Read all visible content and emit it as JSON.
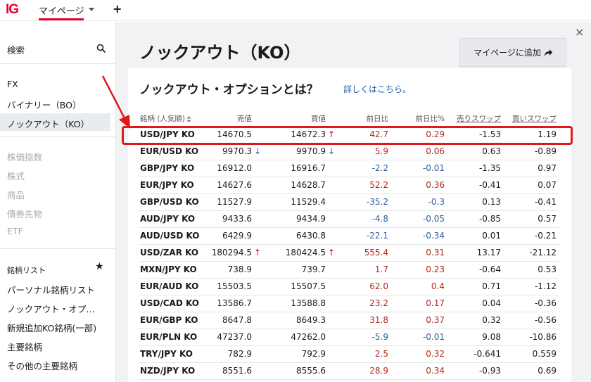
{
  "topbar": {
    "logo": "IG",
    "mypage_tab": "マイページ",
    "plus": "+"
  },
  "sidebar": {
    "search_label": "検索",
    "items": [
      {
        "label": "FX",
        "enabled": true
      },
      {
        "label": "バイナリー（BO）",
        "enabled": true
      },
      {
        "label": "ノックアウト（KO）",
        "enabled": true,
        "active": true
      },
      {
        "label": "株価指数",
        "enabled": false
      },
      {
        "label": "株式",
        "enabled": false
      },
      {
        "label": "商品",
        "enabled": false
      },
      {
        "label": "債券先物",
        "enabled": false
      },
      {
        "label": "ETF",
        "enabled": false
      }
    ],
    "watchlist_title": "銘柄リスト",
    "watchlists": [
      {
        "label": "パーソナル銘柄リスト"
      },
      {
        "label": "ノックアウト・オプ…"
      },
      {
        "label": "新規追加KO銘柄(一部)"
      },
      {
        "label": "主要銘柄"
      },
      {
        "label": "その他の主要銘柄"
      }
    ]
  },
  "main": {
    "page_title": "ノックアウト（KO）",
    "add_button": "マイページに追加",
    "close": "×",
    "card_title": "ノックアウト・オプションとは？",
    "card_link": "詳しくはこちら。"
  },
  "table": {
    "headers": {
      "name": "銘柄 (人気順)",
      "sell": "売値",
      "buy": "買値",
      "change": "前日比",
      "change_pct": "前日比%",
      "sell_swap": "売りスワップ",
      "buy_swap": "買いスワップ"
    },
    "rows": [
      {
        "name": "USD/JPY KO",
        "sell": "14670.5",
        "sell_arrow": "",
        "buy": "14672.3",
        "buy_arrow": "↑",
        "change": "42.7",
        "change_pct": "0.29",
        "sell_swap": "-1.53",
        "buy_swap": "1.19"
      },
      {
        "name": "EUR/USD KO",
        "sell": "9970.3",
        "sell_arrow": "↓",
        "buy": "9970.9",
        "buy_arrow": "↓",
        "change": "5.9",
        "change_pct": "0.06",
        "sell_swap": "0.63",
        "buy_swap": "-0.89"
      },
      {
        "name": "GBP/JPY KO",
        "sell": "16912.0",
        "sell_arrow": "",
        "buy": "16916.7",
        "buy_arrow": "",
        "change": "-2.2",
        "change_pct": "-0.01",
        "sell_swap": "-1.35",
        "buy_swap": "0.97"
      },
      {
        "name": "EUR/JPY KO",
        "sell": "14627.6",
        "sell_arrow": "",
        "buy": "14628.7",
        "buy_arrow": "",
        "change": "52.2",
        "change_pct": "0.36",
        "sell_swap": "-0.41",
        "buy_swap": "0.07"
      },
      {
        "name": "GBP/USD KO",
        "sell": "11527.9",
        "sell_arrow": "",
        "buy": "11529.4",
        "buy_arrow": "",
        "change": "-35.2",
        "change_pct": "-0.3",
        "sell_swap": "0.13",
        "buy_swap": "-0.41"
      },
      {
        "name": "AUD/JPY KO",
        "sell": "9433.6",
        "sell_arrow": "",
        "buy": "9434.9",
        "buy_arrow": "",
        "change": "-4.8",
        "change_pct": "-0.05",
        "sell_swap": "-0.85",
        "buy_swap": "0.57"
      },
      {
        "name": "AUD/USD KO",
        "sell": "6429.9",
        "sell_arrow": "",
        "buy": "6430.8",
        "buy_arrow": "",
        "change": "-22.1",
        "change_pct": "-0.34",
        "sell_swap": "0.01",
        "buy_swap": "-0.21"
      },
      {
        "name": "USD/ZAR KO",
        "sell": "180294.5",
        "sell_arrow": "↑",
        "buy": "180424.5",
        "buy_arrow": "↑",
        "change": "555.4",
        "change_pct": "0.31",
        "sell_swap": "13.17",
        "buy_swap": "-21.12"
      },
      {
        "name": "MXN/JPY KO",
        "sell": "738.9",
        "sell_arrow": "",
        "buy": "739.7",
        "buy_arrow": "",
        "change": "1.7",
        "change_pct": "0.23",
        "sell_swap": "-0.64",
        "buy_swap": "0.53"
      },
      {
        "name": "EUR/AUD KO",
        "sell": "15503.5",
        "sell_arrow": "",
        "buy": "15507.5",
        "buy_arrow": "",
        "change": "62.0",
        "change_pct": "0.4",
        "sell_swap": "0.71",
        "buy_swap": "-1.12"
      },
      {
        "name": "USD/CAD KO",
        "sell": "13586.7",
        "sell_arrow": "",
        "buy": "13588.8",
        "buy_arrow": "",
        "change": "23.2",
        "change_pct": "0.17",
        "sell_swap": "0.04",
        "buy_swap": "-0.36"
      },
      {
        "name": "EUR/GBP KO",
        "sell": "8647.8",
        "sell_arrow": "",
        "buy": "8649.3",
        "buy_arrow": "",
        "change": "31.8",
        "change_pct": "0.37",
        "sell_swap": "0.32",
        "buy_swap": "-0.56"
      },
      {
        "name": "EUR/PLN KO",
        "sell": "47237.0",
        "sell_arrow": "",
        "buy": "47262.0",
        "buy_arrow": "",
        "change": "-5.9",
        "change_pct": "-0.01",
        "sell_swap": "9.08",
        "buy_swap": "-10.86"
      },
      {
        "name": "TRY/JPY KO",
        "sell": "782.9",
        "sell_arrow": "",
        "buy": "792.9",
        "buy_arrow": "",
        "change": "2.5",
        "change_pct": "0.32",
        "sell_swap": "-0.641",
        "buy_swap": "0.559"
      },
      {
        "name": "NZD/JPY KO",
        "sell": "8551.6",
        "sell_arrow": "",
        "buy": "8555.6",
        "buy_arrow": "",
        "change": "28.9",
        "change_pct": "0.34",
        "sell_swap": "-0.93",
        "buy_swap": "0.69"
      }
    ]
  },
  "colors": {
    "brand": "#e4002b",
    "positive": "#b3261e",
    "negative": "#2c5e9e",
    "highlight": "#e0181b"
  }
}
